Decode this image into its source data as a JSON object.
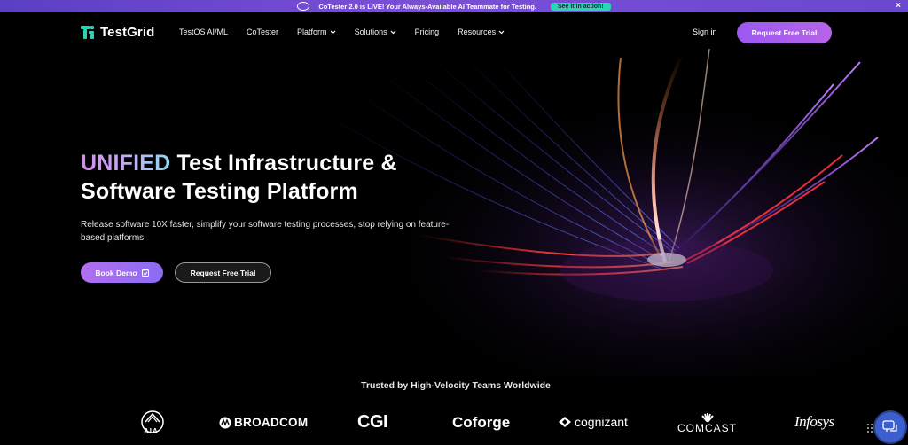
{
  "announcement": {
    "text": "CoTester 2.0 is LIVE! Your Always-Available AI Teammate for Testing.",
    "cta": "See it in action!",
    "close": "×"
  },
  "nav": {
    "brand": "TestGrid",
    "links": [
      "TestOS AI/ML",
      "CoTester",
      "Platform",
      "Solutions",
      "Pricing",
      "Resources"
    ],
    "sign_in": "Sign in",
    "cta": "Request Free Trial"
  },
  "hero": {
    "headline_accent": "UNIFIED",
    "headline_rest_1": " Test Infrastructure &",
    "headline_line_2": "Software Testing Platform",
    "subtext": "Release software 10X faster, simplify your software testing processes, stop relying on feature-based platforms.",
    "primary_button": "Book Demo",
    "secondary_button": "Request Free Trial"
  },
  "trusted": {
    "heading": "Trusted by High-Velocity Teams Worldwide",
    "logos": [
      "AIA",
      "BROADCOM",
      "CGI",
      "Coforge",
      "cognizant",
      "COMCAST",
      "Infosys"
    ]
  },
  "colors": {
    "accent_purple": "#a35ff0",
    "brand_teal": "#2bd4b4",
    "chat_blue": "#3b5fcf"
  }
}
